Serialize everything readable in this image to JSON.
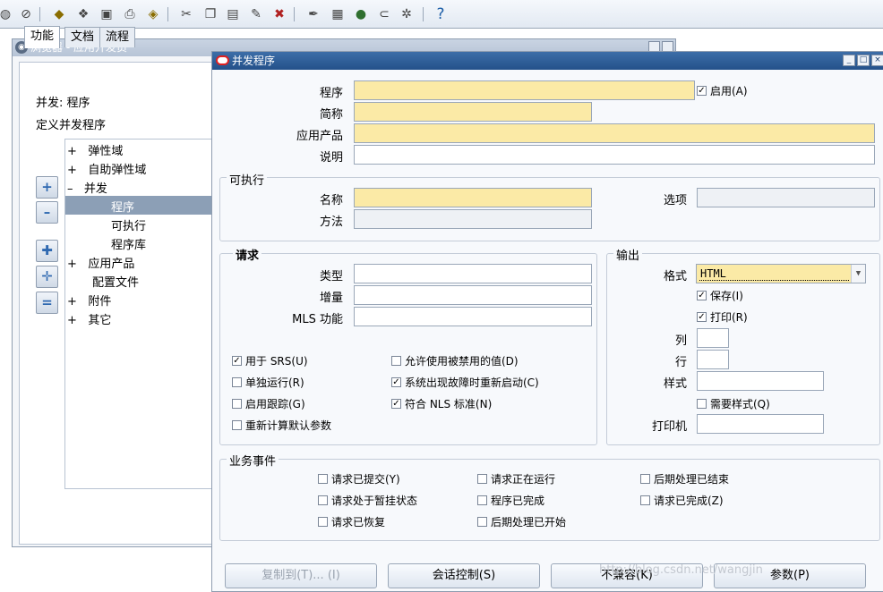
{
  "toolbar": {
    "icons": [
      "back-icon",
      "navigate-icon",
      "save-icon",
      "print-setup-icon",
      "open-icon",
      "print-icon",
      "attachment-icon",
      "cut-icon",
      "copy-icon",
      "paste-icon",
      "edit-icon",
      "delete-record-icon",
      "pen-icon",
      "window-icon",
      "globe-icon",
      "clip-icon",
      "tools-icon"
    ],
    "help_glyph": "?"
  },
  "navigator": {
    "title": "浏览器 - 应用开发员",
    "tabs": [
      {
        "label": "功能"
      },
      {
        "label": "文档"
      },
      {
        "label": "流程"
      }
    ],
    "active_tab": "功能",
    "context": "并发: 程序",
    "heading": "定义并发程序",
    "tree": [
      {
        "prefix": "+",
        "label": "弹性域"
      },
      {
        "prefix": "+",
        "label": "自助弹性域"
      },
      {
        "prefix": "–",
        "label": "并发"
      },
      {
        "prefix": "",
        "label": "程序"
      },
      {
        "prefix": "",
        "label": "可执行"
      },
      {
        "prefix": "",
        "label": "程序库"
      },
      {
        "prefix": "+",
        "label": "应用产品"
      },
      {
        "prefix": "",
        "label": "配置文件"
      },
      {
        "prefix": "+",
        "label": "附件"
      },
      {
        "prefix": "+",
        "label": "其它"
      }
    ]
  },
  "form": {
    "title": "并发程序",
    "program": {
      "label": "程序",
      "value": ""
    },
    "enabled": {
      "label": "启用(A)",
      "checked": true
    },
    "short_name": {
      "label": "简称",
      "value": ""
    },
    "application": {
      "label": "应用产品",
      "value": ""
    },
    "description": {
      "label": "说明",
      "value": ""
    },
    "executable": {
      "title": "可执行",
      "name_label": "名称",
      "method_label": "方法",
      "options_label": "选项"
    },
    "request": {
      "title": "请求",
      "type_label": "类型",
      "increment_label": "增量",
      "mls_label": "MLS 功能",
      "checks": [
        {
          "label": "用于 SRS(U)",
          "checked": true
        },
        {
          "label": "允许使用被禁用的值(D)",
          "checked": false
        },
        {
          "label": "单独运行(R)",
          "checked": false
        },
        {
          "label": "系统出现故障时重新启动(C)",
          "checked": true
        },
        {
          "label": "启用跟踪(G)",
          "checked": false
        },
        {
          "label": "符合 NLS 标准(N)",
          "checked": true
        },
        {
          "label": "重新计算默认参数",
          "checked": false
        }
      ]
    },
    "output": {
      "title": "输出",
      "format_label": "格式",
      "format_value": "HTML",
      "save": {
        "label": "保存(I)",
        "checked": true
      },
      "print": {
        "label": "打印(R)",
        "checked": true
      },
      "columns_label": "列",
      "rows_label": "行",
      "style_label": "样式",
      "style_required": {
        "label": "需要样式(Q)",
        "checked": false
      },
      "printer_label": "打印机"
    },
    "business_events": {
      "title": "业务事件",
      "checks": [
        {
          "label": "请求已提交(Y)",
          "checked": false
        },
        {
          "label": "请求正在运行",
          "checked": false
        },
        {
          "label": "后期处理已结束",
          "checked": false
        },
        {
          "label": "请求处于暂挂状态",
          "checked": false
        },
        {
          "label": "程序已完成",
          "checked": false
        },
        {
          "label": "请求已完成(Z)",
          "checked": false
        },
        {
          "label": "请求已恢复",
          "checked": false
        },
        {
          "label": "后期处理已开始",
          "checked": false
        }
      ]
    },
    "buttons": {
      "copy_to": "复制到(T)... (I)",
      "session_control": "会话控制(S)",
      "incompatible": "不兼容(K)",
      "parameters": "参数(P)"
    },
    "watermark": "http://blog.csdn.net/wangjin"
  },
  "colors": {
    "required_field": "#fbeaa6",
    "title_bar": "#24518a",
    "tree_selected": "#8c9fb6"
  }
}
